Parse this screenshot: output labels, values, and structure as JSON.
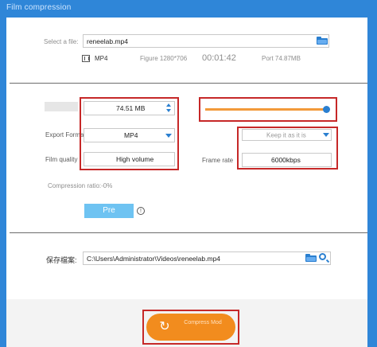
{
  "window": {
    "title": "Film compression"
  },
  "file": {
    "label": "Select a file:",
    "value": "reneelab.mp4",
    "format": "MP4",
    "resolution": "Figure 1280*706",
    "duration": "00:01:42",
    "size": "Port 74.87MB"
  },
  "settings": {
    "size_value": "74.51 MB",
    "export_format_label": "Export Format",
    "export_format_value": "MP4",
    "film_quality_label": "Film quality",
    "film_quality_value": "High volume",
    "resolution_value": "Keep it as it is",
    "frame_rate_label": "Frame rate",
    "frame_rate_value": "6000kbps",
    "compression_ratio": "Compression ratio:-0%",
    "preview_label": "Pre",
    "info_icon_glyph": "!"
  },
  "save": {
    "label": "保存檔案:",
    "path": "C:\\Users\\Administrator\\Videos\\reneelab.mp4"
  },
  "action": {
    "compress_label": "Compress Mod",
    "compress_icon": "↻"
  },
  "colors": {
    "accent_blue": "#2a7fd0",
    "highlight_red": "#c62828",
    "orange": "#f28c1e"
  }
}
